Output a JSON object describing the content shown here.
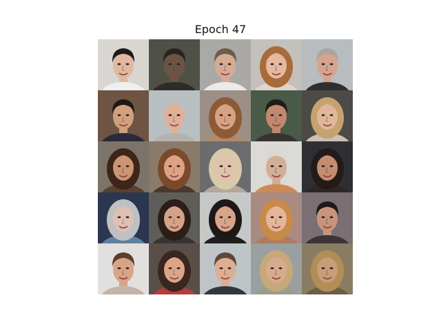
{
  "title": "Epoch 47",
  "grid": {
    "rows": 5,
    "cols": 5,
    "cells": [
      {
        "bg": "#d9d6d2",
        "skin": "#e0b9a0",
        "hair": "#1d1a18",
        "shirt": "#efefef",
        "style": "short"
      },
      {
        "bg": "#4f5147",
        "skin": "#6a5545",
        "hair": "#2a2420",
        "shirt": "#2e2b29",
        "style": "short"
      },
      {
        "bg": "#aaa9a6",
        "skin": "#d7aa93",
        "hair": "#6e5b4b",
        "shirt": "#ecebea",
        "style": "short"
      },
      {
        "bg": "#c4c0bc",
        "skin": "#e6b99f",
        "hair": "#a86c3a",
        "shirt": "#e1d5c7",
        "style": "long"
      },
      {
        "bg": "#b9bcbe",
        "skin": "#d4a48e",
        "hair": "#a9a6a2",
        "shirt": "#2f2e31",
        "style": "short"
      },
      {
        "bg": "#6d5443",
        "skin": "#d1a07f",
        "hair": "#1f1815",
        "shirt": "#2b2a3a",
        "style": "short"
      },
      {
        "bg": "#b9c0c4",
        "skin": "#dfb198",
        "hair": "#c8a188",
        "shirt": "#b5b2ad",
        "style": "bald"
      },
      {
        "bg": "#9c8f86",
        "skin": "#d7a282",
        "hair": "#8c5a34",
        "shirt": "#b08a6b",
        "style": "long"
      },
      {
        "bg": "#4a5a48",
        "skin": "#c08970",
        "hair": "#221c19",
        "shirt": "#373331",
        "style": "short"
      },
      {
        "bg": "#4b4a47",
        "skin": "#e0b79a",
        "hair": "#c6a36e",
        "shirt": "#cdbfb3",
        "style": "long"
      },
      {
        "bg": "#7c7468",
        "skin": "#cc9473",
        "hair": "#3d2519",
        "shirt": "#5b4032",
        "style": "long"
      },
      {
        "bg": "#8a7a6a",
        "skin": "#dca283",
        "hair": "#7a4a2a",
        "shirt": "#48382d",
        "style": "long"
      },
      {
        "bg": "#6a6c6e",
        "skin": "#dfc3ad",
        "hair": "#d9c9aa",
        "shirt": "#b5a79a",
        "style": "long"
      },
      {
        "bg": "#dcdad6",
        "skin": "#d1ae96",
        "hair": "#ddd8cf",
        "shirt": "#cd8a56",
        "style": "short"
      },
      {
        "bg": "#2d2f33",
        "skin": "#c48c71",
        "hair": "#241b18",
        "shirt": "#2f2522",
        "style": "long"
      },
      {
        "bg": "#2c3650",
        "skin": "#dfc0b5",
        "hair": "#bfc0c2",
        "shirt": "#6080a0",
        "style": "long"
      },
      {
        "bg": "#5f5d59",
        "skin": "#d3a288",
        "hair": "#2b1d17",
        "shirt": "#3a3231",
        "style": "long"
      },
      {
        "bg": "#c6c8c8",
        "skin": "#d7a58a",
        "hair": "#1e1817",
        "shirt": "#1f1f22",
        "style": "long"
      },
      {
        "bg": "#a98b82",
        "skin": "#e4b59a",
        "hair": "#c88a48",
        "shirt": "#b07a60",
        "style": "long"
      },
      {
        "bg": "#7a6f74",
        "skin": "#c7957c",
        "hair": "#1f1918",
        "shirt": "#3b3536",
        "style": "short"
      },
      {
        "bg": "#e2e0de",
        "skin": "#d7a486",
        "hair": "#5e3d29",
        "shirt": "#c3b3a9",
        "style": "short"
      },
      {
        "bg": "#5a4e48",
        "skin": "#dca58a",
        "hair": "#3a2620",
        "shirt": "#b63b3b",
        "style": "long"
      },
      {
        "bg": "#bfc4c7",
        "skin": "#dcae93",
        "hair": "#5b473b",
        "shirt": "#2f3740",
        "style": "short"
      },
      {
        "bg": "#9aa0a0",
        "skin": "#d7ac8e",
        "hair": "#c6a979",
        "shirt": "#9c9c8e",
        "style": "long"
      },
      {
        "bg": "#8a7c62",
        "skin": "#c89e78",
        "hair": "#b38d58",
        "shirt": "#6f5c44",
        "style": "long"
      }
    ]
  }
}
